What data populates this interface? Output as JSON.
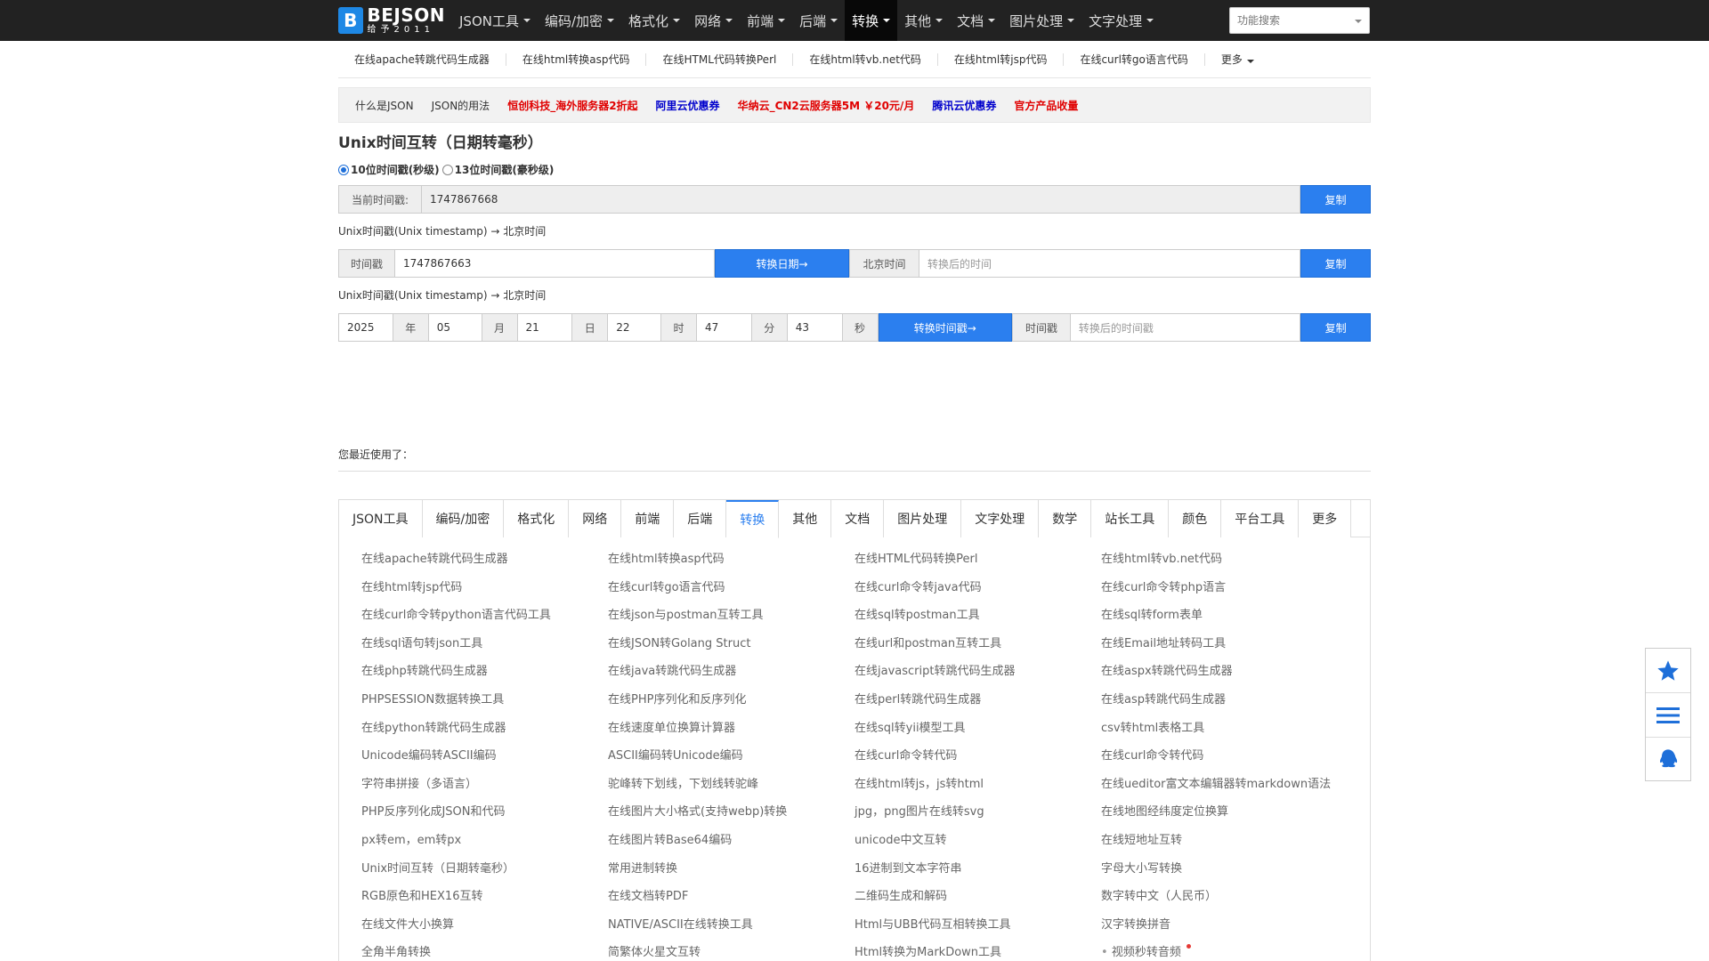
{
  "brand": {
    "logo_letter": "B",
    "name": "BEJSON",
    "sub": "给予2011"
  },
  "nav": [
    {
      "label": "JSON工具",
      "active": false
    },
    {
      "label": "编码/加密",
      "active": false
    },
    {
      "label": "格式化",
      "active": false
    },
    {
      "label": "网络",
      "active": false
    },
    {
      "label": "前端",
      "active": false
    },
    {
      "label": "后端",
      "active": false
    },
    {
      "label": "转换",
      "active": true
    },
    {
      "label": "其他",
      "active": false
    },
    {
      "label": "文档",
      "active": false
    },
    {
      "label": "图片处理",
      "active": false
    },
    {
      "label": "文字处理",
      "active": false
    }
  ],
  "search": {
    "placeholder": "功能搜索"
  },
  "subnav": [
    "在线apache转跳代码生成器",
    "在线html转换asp代码",
    "在线HTML代码转换Perl",
    "在线html转vb.net代码",
    "在线html转jsp代码",
    "在线curl转go语言代码",
    "更多"
  ],
  "promo": [
    {
      "label": "什么是JSON",
      "color": "#333333"
    },
    {
      "label": "JSON的用法",
      "color": "#333333"
    },
    {
      "label": "恒创科技_海外服务器2折起",
      "color": "#e00000"
    },
    {
      "label": "阿里云优惠券",
      "color": "#0000cc"
    },
    {
      "label": "华纳云_CN2云服务器5M ￥20元/月",
      "color": "#e00000"
    },
    {
      "label": "腾讯云优惠券",
      "color": "#0000cc"
    },
    {
      "label": "官方产品收量",
      "color": "#e00000"
    }
  ],
  "title": "Unix时间互转（日期转毫秒）",
  "radios": {
    "opt10": "10位时间戳(秒级)",
    "opt13": "13位时间戳(豪秒级)"
  },
  "current": {
    "label": "当前时间戳:",
    "value": "1747867668",
    "copy": "复制"
  },
  "caption1": "Unix时间戳(Unix timestamp) → 北京时间",
  "ts_to_date": {
    "label": "时间戳",
    "value": "1747867663",
    "button": "转换日期→",
    "out_label": "北京时间",
    "out_placeholder": "转换后的时间",
    "copy": "复制"
  },
  "caption2": "Unix时间戳(Unix timestamp) → 北京时间",
  "date_to_ts": {
    "year": "2025",
    "year_label": "年",
    "month": "05",
    "month_label": "月",
    "day": "21",
    "day_label": "日",
    "hour": "22",
    "hour_label": "时",
    "minute": "47",
    "minute_label": "分",
    "second": "43",
    "second_label": "秒",
    "button": "转换时间戳→",
    "out_label": "时间戳",
    "out_placeholder": "转换后的时间戳",
    "copy": "复制"
  },
  "recent": "您最近使用了：",
  "tabs": [
    {
      "label": "JSON工具",
      "active": false
    },
    {
      "label": "编码/加密",
      "active": false
    },
    {
      "label": "格式化",
      "active": false
    },
    {
      "label": "网络",
      "active": false
    },
    {
      "label": "前端",
      "active": false
    },
    {
      "label": "后端",
      "active": false
    },
    {
      "label": "转换",
      "active": true
    },
    {
      "label": "其他",
      "active": false
    },
    {
      "label": "文档",
      "active": false
    },
    {
      "label": "图片处理",
      "active": false
    },
    {
      "label": "文字处理",
      "active": false
    },
    {
      "label": "数学",
      "active": false
    },
    {
      "label": "站长工具",
      "active": false
    },
    {
      "label": "颜色",
      "active": false
    },
    {
      "label": "平台工具",
      "active": false
    },
    {
      "label": "更多",
      "active": false
    }
  ],
  "links": [
    "在线apache转跳代码生成器",
    "在线html转换asp代码",
    "在线HTML代码转换Perl",
    "在线html转vb.net代码",
    "在线html转jsp代码",
    "在线curl转go语言代码",
    "在线curl命令转java代码",
    "在线curl命令转php语言",
    "在线curl命令转python语言代码工具",
    "在线json与postman互转工具",
    "在线sql转postman工具",
    "在线sql转form表单",
    "在线sql语句转json工具",
    "在线JSON转Golang Struct",
    "在线url和postman互转工具",
    "在线Email地址转码工具",
    "在线php转跳代码生成器",
    "在线java转跳代码生成器",
    "在线javascript转跳代码生成器",
    "在线aspx转跳代码生成器",
    "PHPSESSION数据转换工具",
    "在线PHP序列化和反序列化",
    "在线perl转跳代码生成器",
    "在线asp转跳代码生成器",
    "在线python转跳代码生成器",
    "在线速度单位换算计算器",
    "在线sql转yii模型工具",
    "csv转html表格工具",
    "Unicode编码转ASCII编码",
    "ASCII编码转Unicode编码",
    "在线curl命令转代码",
    "在线curl命令转代码",
    "字符串拼接（多语言）",
    "驼峰转下划线，下划线转驼峰",
    "在线html转js，js转html",
    "在线ueditor富文本编辑器转markdown语法",
    "PHP反序列化成JSON和代码",
    "在线图片大小格式(支持webp)转换",
    "jpg，png图片在线转svg",
    "在线地图经纬度定位换算",
    "px转em，em转px",
    "在线图片转Base64编码",
    "unicode中文互转",
    "在线短地址互转",
    "Unix时间互转（日期转毫秒）",
    "常用进制转换",
    "16进制到文本字符串",
    "字母大小写转换",
    "RGB原色和HEX16互转",
    "在线文档转PDF",
    "二维码生成和解码",
    "数字转中文（人民币）",
    "在线文件大小换算",
    "NATIVE/ASCII在线转换工具",
    "Html与UBB代码互相转换工具",
    "汉字转换拼音",
    "全角半角转换",
    "简繁体火星文互转",
    "Html转换为MarkDown工具",
    "视频秒转音频"
  ],
  "float": [
    "star-icon",
    "menu-icon",
    "qq-icon"
  ],
  "colors": {
    "accent": "#2b7fef",
    "topbar": "#222222"
  }
}
